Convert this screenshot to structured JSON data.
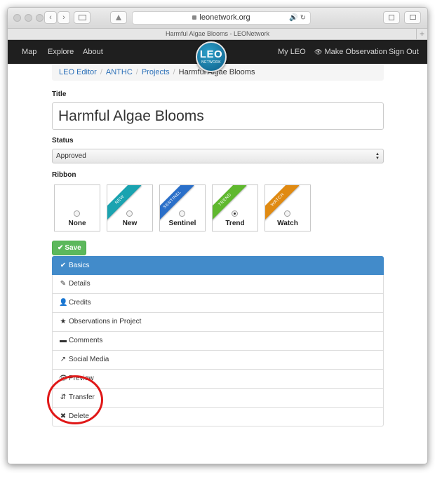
{
  "browser": {
    "url": "leonetwork.org",
    "tab_title": "Harmful Algae Blooms - LEONetwork",
    "new_tab_glyph": "+",
    "back_glyph": "‹",
    "forward_glyph": "›",
    "reload_glyph": "↻",
    "audio_glyph": "🔊"
  },
  "navbar": {
    "left": [
      "Map",
      "Explore",
      "About"
    ],
    "right": [
      "My LEO",
      "Make Observation",
      "Sign Out"
    ],
    "logo_main": "LEO",
    "logo_sub": "NETWORK",
    "eye_glyph": "👁"
  },
  "breadcrumb": {
    "items": [
      "LEO Editor",
      "ANTHC",
      "Projects"
    ],
    "current": "Harmful Algae Blooms",
    "separator": "/"
  },
  "form": {
    "title_label": "Title",
    "title_value": "Harmful Algae Blooms",
    "status_label": "Status",
    "status_value": "Approved",
    "ribbon_label": "Ribbon",
    "ribbons": [
      {
        "name": "None",
        "band": "",
        "color": "",
        "checked": false
      },
      {
        "name": "New",
        "band": "NEW",
        "color": "#1aa3b0",
        "checked": false
      },
      {
        "name": "Sentinel",
        "band": "SENTINEL",
        "color": "#2a6fc9",
        "checked": false
      },
      {
        "name": "Trend",
        "band": "TREND",
        "color": "#5fb82e",
        "checked": true
      },
      {
        "name": "Watch",
        "band": "WATCH",
        "color": "#e08a12",
        "checked": false
      }
    ],
    "save_label": "Save",
    "save_glyph": "✔"
  },
  "menu": [
    {
      "label": "Basics",
      "icon": "check-icon",
      "glyph": "✔",
      "active": true
    },
    {
      "label": "Details",
      "icon": "pencil-icon",
      "glyph": "✎",
      "active": false
    },
    {
      "label": "Credits",
      "icon": "user-icon",
      "glyph": "👤",
      "active": false
    },
    {
      "label": "Observations in Project",
      "icon": "star-icon",
      "glyph": "★",
      "active": false
    },
    {
      "label": "Comments",
      "icon": "comment-icon",
      "glyph": "▬",
      "active": false
    },
    {
      "label": "Social Media",
      "icon": "share-icon",
      "glyph": "↗",
      "active": false
    },
    {
      "label": "Preview",
      "icon": "eye-icon",
      "glyph": "👁",
      "active": false
    },
    {
      "label": "Transfer",
      "icon": "transfer-icon",
      "glyph": "⇵",
      "active": false
    },
    {
      "label": "Delete",
      "icon": "times-icon",
      "glyph": "✖",
      "active": false
    }
  ],
  "colors": {
    "navbar_bg": "#1f1f1f",
    "active_item": "#428bca",
    "save_green": "#5cb85c",
    "link_blue": "#2a6fb8",
    "annotation_red": "#e01818"
  }
}
